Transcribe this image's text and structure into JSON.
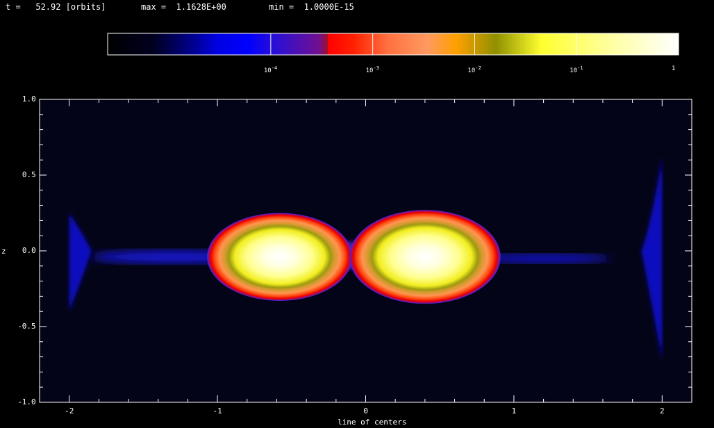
{
  "header": {
    "time_text": "t =   52.92 [orbits]",
    "max_text": "max =  1.1628E+00",
    "min_text": "min =  1.0000E-15"
  },
  "colorbar": {
    "ticks": [
      {
        "base": "10",
        "exp": "-4",
        "value": 0.0001
      },
      {
        "base": "10",
        "exp": "-3",
        "value": 0.001
      },
      {
        "base": "10",
        "exp": "-2",
        "value": 0.01
      },
      {
        "base": "10",
        "exp": "-1",
        "value": 0.1
      },
      {
        "base": "1",
        "exp": "",
        "value": 1
      }
    ],
    "colors": [
      "#000000",
      "#000030",
      "#0000a0",
      "#0000ff",
      "#5010c0",
      "#8a1090",
      "#b00010",
      "#ff0000",
      "#ff5000",
      "#ff9a60",
      "#ff9a00",
      "#909000",
      "#ffff40",
      "#ffffa0",
      "#ffffff"
    ]
  },
  "chart_data": {
    "type": "heatmap",
    "title": "",
    "xlabel": "line of centers",
    "ylabel": "z",
    "xlim": [
      -2.2,
      2.2
    ],
    "ylim": [
      -1.0,
      1.0
    ],
    "x_ticks": [
      {
        "v": -2,
        "label": "-2"
      },
      {
        "v": -1,
        "label": "-1"
      },
      {
        "v": 0,
        "label": "0"
      },
      {
        "v": 1,
        "label": "1"
      },
      {
        "v": 2,
        "label": "2"
      }
    ],
    "y_ticks": [
      {
        "v": 1.0,
        "label": "1.0"
      },
      {
        "v": 0.5,
        "label": "0.5"
      },
      {
        "v": 0.0,
        "label": "0.0"
      },
      {
        "v": -0.5,
        "label": "-0.5"
      },
      {
        "v": -1.0,
        "label": "-1.0"
      }
    ],
    "scale": "log",
    "stars": [
      {
        "cx": -0.58,
        "cy": -0.04,
        "rx": 0.49,
        "ry": 0.29
      },
      {
        "cx": 0.4,
        "cy": -0.04,
        "rx": 0.51,
        "ry": 0.31
      }
    ],
    "background_color": "#040418"
  }
}
